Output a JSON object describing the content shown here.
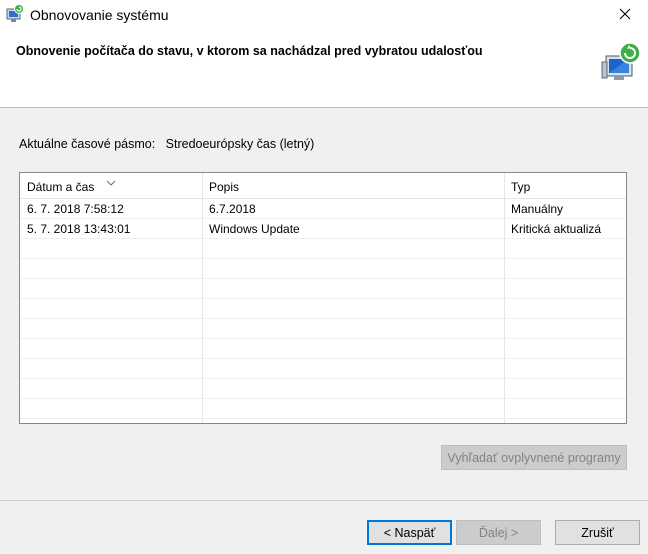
{
  "window": {
    "title": "Obnovovanie systému",
    "heading": "Obnovenie počítača do stavu, v ktorom sa nachádzal pred vybratou udalosťou"
  },
  "timezone": {
    "label": "Aktuálne časové pásmo:",
    "value": "Stredoeurópsky čas (letný)"
  },
  "table": {
    "headers": [
      "Dátum a čas",
      "Popis",
      "Typ"
    ],
    "rows": [
      [
        "6. 7. 2018 7:58:12",
        "6.7.2018",
        "Manuálny"
      ],
      [
        "5. 7. 2018 13:43:01",
        "Windows Update",
        "Kritická aktualizá"
      ]
    ]
  },
  "buttons": {
    "scan": "Vyhľadať ovplyvnené programy",
    "back": "< Naspäť",
    "next": "Ďalej >",
    "cancel": "Zrušiť"
  },
  "icons": {
    "app": "system-restore-icon",
    "header": "system-restore-large-icon",
    "close": "close-icon",
    "sort": "sort-arrow-icon"
  }
}
